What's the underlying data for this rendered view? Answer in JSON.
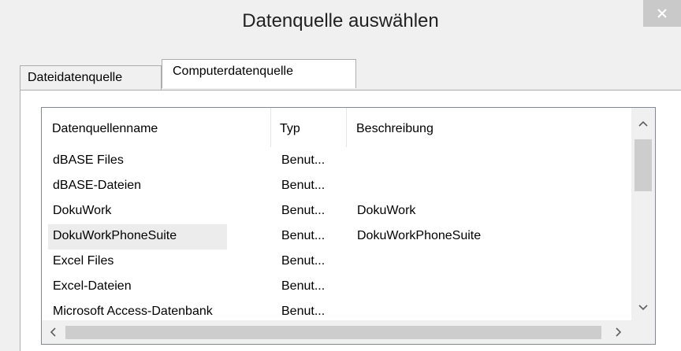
{
  "window": {
    "title": "Datenquelle auswählen",
    "close_icon": "close-icon"
  },
  "tabs": [
    {
      "label": "Dateidatenquelle",
      "selected": false
    },
    {
      "label": "Computerdatenquelle",
      "selected": true
    }
  ],
  "list": {
    "columns": [
      "Datenquellenname",
      "Typ",
      "Beschreibung"
    ],
    "rows": [
      {
        "name": "dBASE Files",
        "type": "Benut...",
        "description": ""
      },
      {
        "name": "dBASE-Dateien",
        "type": "Benut...",
        "description": ""
      },
      {
        "name": "DokuWork",
        "type": "Benut...",
        "description": "DokuWork"
      },
      {
        "name": "DokuWorkPhoneSuite",
        "type": "Benut...",
        "description": "DokuWorkPhoneSuite"
      },
      {
        "name": "Excel Files",
        "type": "Benut...",
        "description": ""
      },
      {
        "name": "Excel-Dateien",
        "type": "Benut...",
        "description": ""
      },
      {
        "name": "Microsoft Access-Datenbank",
        "type": "Benut...",
        "description": ""
      }
    ],
    "hovered_row": "DokuWorkPhoneSuite"
  },
  "colors": {
    "background": "#f0f0f0",
    "scroll_thumb": "#cdcdcd",
    "hover": "#ececec"
  }
}
